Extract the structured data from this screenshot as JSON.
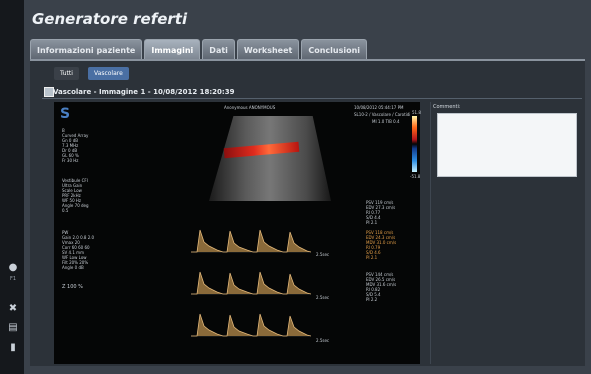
{
  "app": {
    "title": "Generatore referti"
  },
  "tabs": [
    {
      "label": "Informazioni paziente"
    },
    {
      "label": "Immagini"
    },
    {
      "label": "Dati"
    },
    {
      "label": "Worksheet"
    },
    {
      "label": "Conclusioni"
    }
  ],
  "filters": {
    "all": "Tutti",
    "vascular": "Vascolare"
  },
  "image": {
    "header": "Vascolare - Immagine 1 - 10/08/2012 18:20:39",
    "top_center": "Anonymous ANONYMOUS",
    "top_right": "10/08/2012 05:44:17 PM",
    "top_right2": "SL10-2 / Vascolare / Carotidi",
    "hosp": "St. Ospitale: 7547087",
    "mi": "MI 1.0  TIB 0.4",
    "scale_top": "51.8",
    "scale_bot": "-51.8",
    "left_params": [
      "B",
      "Curved Array",
      "Gn 0 dB",
      "7.3 MHz",
      "Dr 0 dB",
      "GL 60 %",
      "Fr 30 Hz"
    ],
    "left_params2": [
      "Vestibule CFI",
      "Ultra Gain",
      "Scale Low",
      "PRF 2kHz",
      "WF 50 Hz",
      "Angle 70 deg",
      "0.5"
    ],
    "left_params3": [
      "PW",
      "Gain 2.0 0.8 2.0",
      "Vmax 20",
      "Corr 60 60 60",
      "SV 4.1 mm",
      "WF Low Low",
      "Filt 20% 20%",
      "Angle 0 dB"
    ],
    "zoom": "Z 100 %",
    "measure_white": [
      "PSV  119 cm/s",
      "EDV  27.3 cm/s",
      "RI   0.77",
      "S/D  4.4",
      "PI   2.1"
    ],
    "measure_orange": [
      "PSV  118 cm/s",
      "EDV  24.3 cm/s",
      "MDV  31.0 cm/s",
      "RI   0.79",
      "S/D  4.6",
      "PI   2.1"
    ],
    "measure_white2": [
      "PSV  144 cm/s",
      "EDV  26.5 cm/s",
      "MDV  31.6 cm/s",
      "RI   0.82",
      "S/D  5.4",
      "PI   2.2"
    ],
    "time_labels": [
      "2.5sec",
      "2.5sec",
      "2.5sec"
    ]
  },
  "comments": {
    "label": "Commenti:",
    "value": ""
  },
  "sidebar": {
    "items": [
      {
        "icon": "info-icon",
        "label": "F1"
      },
      {
        "icon": "close-icon",
        "label": ""
      },
      {
        "icon": "print-icon",
        "label": ""
      },
      {
        "icon": "bar-icon",
        "label": ""
      }
    ]
  },
  "colors": {
    "accent": "#4a6fa3",
    "background": "#3a414a"
  }
}
